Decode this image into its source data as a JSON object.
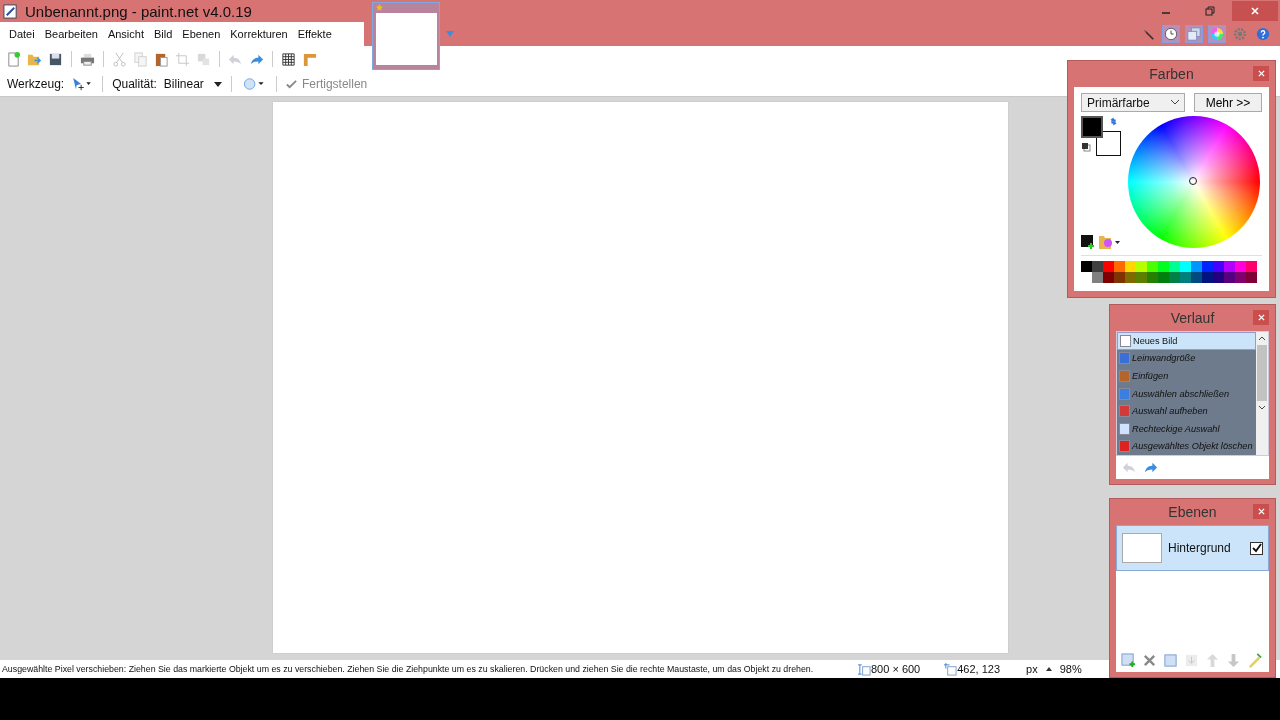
{
  "window": {
    "title": "Unbenannt.png - paint.net v4.0.19"
  },
  "menu": [
    {
      "label": "Datei"
    },
    {
      "label": "Bearbeiten"
    },
    {
      "label": "Ansicht"
    },
    {
      "label": "Bild"
    },
    {
      "label": "Ebenen"
    },
    {
      "label": "Korrekturen"
    },
    {
      "label": "Effekte"
    }
  ],
  "panel_toggles": [
    {
      "kind": "tools",
      "on": false
    },
    {
      "kind": "history",
      "on": true
    },
    {
      "kind": "layers",
      "on": true
    },
    {
      "kind": "colors",
      "on": true
    },
    {
      "kind": "settings",
      "on": false
    },
    {
      "kind": "help",
      "on": false
    }
  ],
  "tool_options": {
    "tool_label": "Werkzeug:",
    "quality_label": "Qualität:",
    "quality_value": "Bilinear",
    "finish": {
      "label": "Fertigstellen",
      "disabled": true
    }
  },
  "colors_panel": {
    "title": "Farben",
    "dropdown": "Primärfarbe",
    "more_button": "Mehr >>",
    "palette_visible": true
  },
  "history_panel": {
    "title": "Verlauf",
    "items": [
      {
        "kind": "new",
        "label": "Neues Bild",
        "selected": true
      },
      {
        "kind": "resize",
        "label": "Leinwandgröße",
        "selected": false
      },
      {
        "kind": "paste",
        "label": "Einfügen",
        "selected": false
      },
      {
        "kind": "move",
        "label": "Auswählen abschließen",
        "selected": false
      },
      {
        "kind": "deselect",
        "label": "Auswahl aufheben",
        "selected": false
      },
      {
        "kind": "select",
        "label": "Rechteckige Auswahl",
        "selected": false
      },
      {
        "kind": "delete",
        "label": "Ausgewähltes Objekt löschen",
        "selected": false
      }
    ]
  },
  "layers_panel": {
    "title": "Ebenen",
    "layers": [
      {
        "name": "Hintergrund",
        "selected": true,
        "visible": true
      }
    ]
  },
  "status_bar": {
    "hint": "Ausgewählte Pixel verschieben: Ziehen Sie das markierte Objekt um es zu verschieben. Ziehen Sie die Ziehpunkte um es zu skalieren. Drücken und ziehen Sie die rechte Maustaste, um das Objekt zu drehen.",
    "image_size": "800 × 600",
    "cursor": "462, 123",
    "unit": "px",
    "zoom": "98%"
  }
}
